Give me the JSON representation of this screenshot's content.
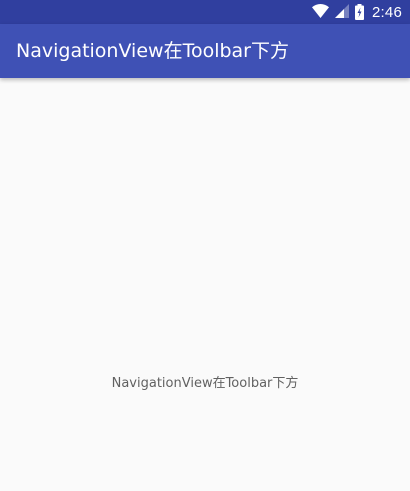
{
  "status_bar": {
    "time": "2:46",
    "icons": [
      "wifi-icon",
      "signal-icon",
      "battery-icon"
    ],
    "background": "#303f9f"
  },
  "toolbar": {
    "title": "NavigationView在Toolbar下方",
    "background": "#3f51b5"
  },
  "content": {
    "text": "NavigationView在Toolbar下方",
    "background": "#fafafa"
  }
}
